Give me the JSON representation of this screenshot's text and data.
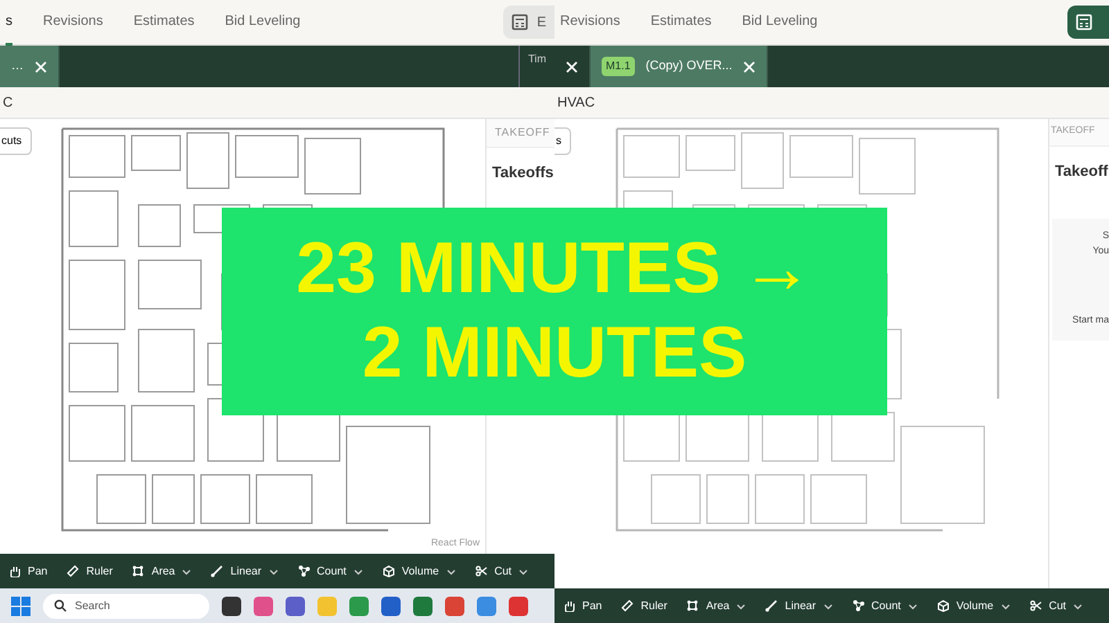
{
  "left_pane": {
    "nav_tabs": [
      {
        "label": "s",
        "selected": true
      },
      {
        "label": "Revisions",
        "selected": false
      },
      {
        "label": "Estimates",
        "selected": false
      },
      {
        "label": "Bid Leveling",
        "selected": false
      }
    ],
    "nav_button": {
      "label": "E",
      "primary": false
    },
    "file_tabs": [
      {
        "label": "…",
        "selected": true
      }
    ],
    "side_label": "Tim",
    "breadcrumb": "C",
    "shortcuts_button": "cuts",
    "panel": {
      "header": "TAKEOFF",
      "title": "Takeoffs"
    },
    "canvas_credit": "React Flow",
    "toolbar": [
      {
        "label": "Pan",
        "has_menu": false
      },
      {
        "label": "Ruler",
        "has_menu": false
      },
      {
        "label": "Area",
        "has_menu": true
      },
      {
        "label": "Linear",
        "has_menu": true
      },
      {
        "label": "Count",
        "has_menu": true
      },
      {
        "label": "Volume",
        "has_menu": true
      },
      {
        "label": "Cut",
        "has_menu": true
      }
    ]
  },
  "taskbar": {
    "search_placeholder": "Search"
  },
  "right_pane": {
    "nav_tabs": [
      {
        "label": "Revisions",
        "selected": false
      },
      {
        "label": "Estimates",
        "selected": false
      },
      {
        "label": "Bid Leveling",
        "selected": false
      }
    ],
    "nav_button": {
      "primary": true
    },
    "file_tabs": [
      {
        "selected": false
      },
      {
        "label": "(Copy) OVER...",
        "badge": "M1.1",
        "selected": true
      }
    ],
    "breadcrumb": "HVAC",
    "shortcuts_button": "s",
    "panel": {
      "header": "TAKEOFF",
      "title": "Takeoff",
      "lines": [
        "S",
        "You",
        "Start ma"
      ]
    },
    "toolbar": [
      {
        "label": "Pan",
        "has_menu": false
      },
      {
        "label": "Ruler",
        "has_menu": false
      },
      {
        "label": "Area",
        "has_menu": true
      },
      {
        "label": "Linear",
        "has_menu": true
      },
      {
        "label": "Count",
        "has_menu": true
      },
      {
        "label": "Volume",
        "has_menu": true
      },
      {
        "label": "Cut",
        "has_menu": true
      }
    ]
  },
  "banner": {
    "lines": [
      "23 MINUTES →",
      "2 MINUTES"
    ]
  }
}
